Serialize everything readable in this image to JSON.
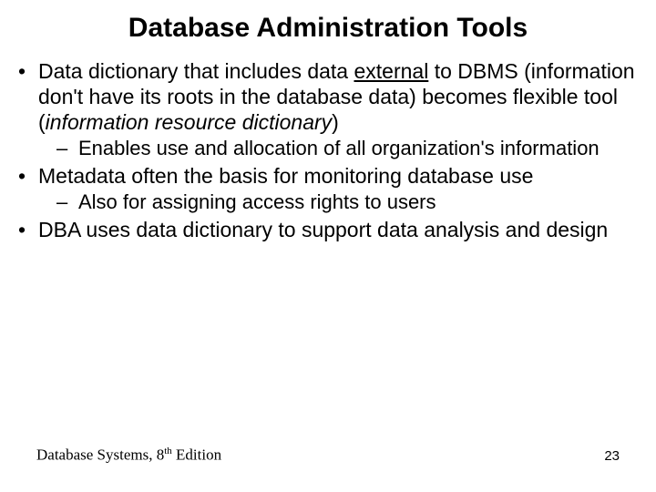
{
  "title": "Database Administration Tools",
  "bullets": {
    "b1_pre": "Data dictionary that includes data ",
    "b1_underlined": "external",
    "b1_mid": " to DBMS (information don't have its roots in the database data) becomes flexible tool (",
    "b1_italic": "information resource dictionary",
    "b1_post": ")",
    "b1_sub1": "Enables use and allocation of all organization's information",
    "b2": "Metadata often the basis for monitoring database use",
    "b2_sub1": "Also for assigning access rights to users",
    "b3": "DBA uses data dictionary to support data analysis and design"
  },
  "footer": {
    "book_pre": "Database Systems, 8",
    "book_sup": "th",
    "book_post": " Edition",
    "page": "23"
  }
}
